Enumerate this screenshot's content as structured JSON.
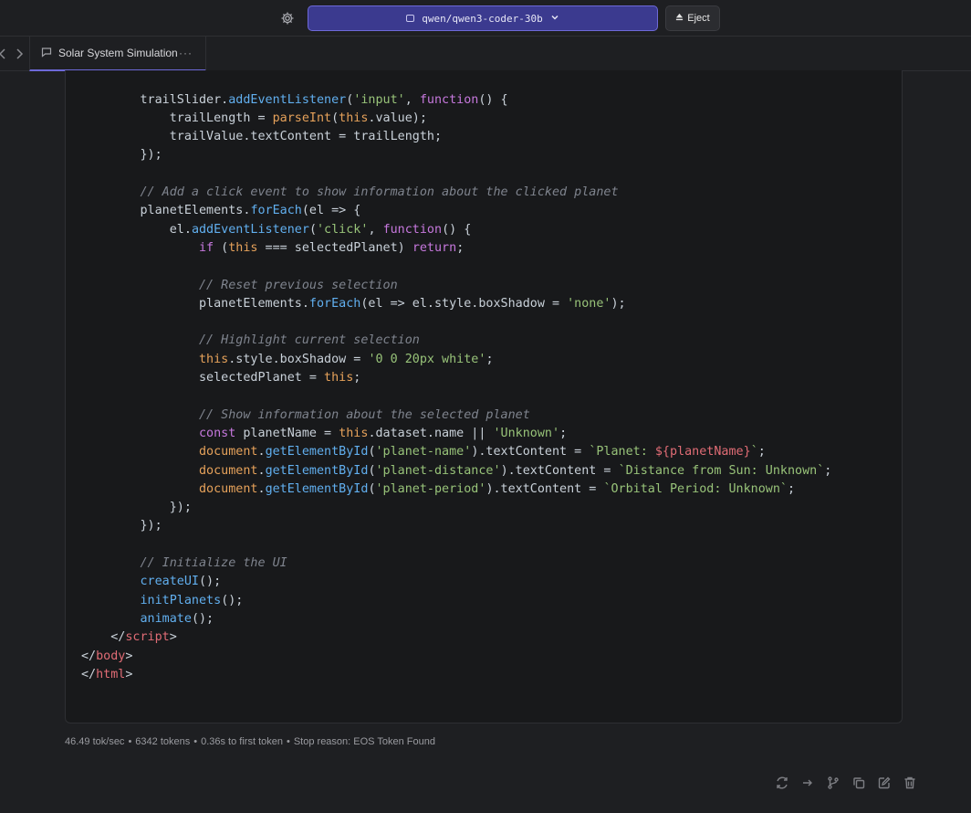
{
  "topbar": {
    "model_name": "qwen/qwen3-coder-30b",
    "eject_label": "Eject"
  },
  "tab": {
    "title": "Solar System Simulation",
    "more_label": "···"
  },
  "code_lines": [
    [
      [
        "p",
        "        });"
      ]
    ],
    [
      [
        "p",
        ""
      ]
    ],
    [
      [
        "p",
        "        trailSlider."
      ],
      [
        "f",
        "addEventListener"
      ],
      [
        "p",
        "("
      ],
      [
        "s",
        "'input'"
      ],
      [
        "p",
        ", "
      ],
      [
        "k",
        "function"
      ],
      [
        "p",
        "() {"
      ]
    ],
    [
      [
        "p",
        "            trailLength = "
      ],
      [
        "t",
        "parseInt"
      ],
      [
        "p",
        "("
      ],
      [
        "t",
        "this"
      ],
      [
        "p",
        ".value);"
      ]
    ],
    [
      [
        "p",
        "            trailValue.textContent = trailLength;"
      ]
    ],
    [
      [
        "p",
        "        });"
      ]
    ],
    [
      [
        "p",
        ""
      ]
    ],
    [
      [
        "c",
        "        // Add a click event to show information about the clicked planet"
      ]
    ],
    [
      [
        "p",
        "        planetElements."
      ],
      [
        "f",
        "forEach"
      ],
      [
        "p",
        "(el => {"
      ]
    ],
    [
      [
        "p",
        "            el."
      ],
      [
        "f",
        "addEventListener"
      ],
      [
        "p",
        "("
      ],
      [
        "s",
        "'click'"
      ],
      [
        "p",
        ", "
      ],
      [
        "k",
        "function"
      ],
      [
        "p",
        "() {"
      ]
    ],
    [
      [
        "p",
        "                "
      ],
      [
        "k",
        "if"
      ],
      [
        "p",
        " ("
      ],
      [
        "t",
        "this"
      ],
      [
        "p",
        " === selectedPlanet) "
      ],
      [
        "k",
        "return"
      ],
      [
        "p",
        ";"
      ]
    ],
    [
      [
        "p",
        ""
      ]
    ],
    [
      [
        "c",
        "                // Reset previous selection"
      ]
    ],
    [
      [
        "p",
        "                planetElements."
      ],
      [
        "f",
        "forEach"
      ],
      [
        "p",
        "(el => el.style.boxShadow = "
      ],
      [
        "s",
        "'none'"
      ],
      [
        "p",
        ");"
      ]
    ],
    [
      [
        "p",
        ""
      ]
    ],
    [
      [
        "c",
        "                // Highlight current selection"
      ]
    ],
    [
      [
        "p",
        "                "
      ],
      [
        "t",
        "this"
      ],
      [
        "p",
        ".style.boxShadow = "
      ],
      [
        "s",
        "'0 0 20px white'"
      ],
      [
        "p",
        ";"
      ]
    ],
    [
      [
        "p",
        "                selectedPlanet = "
      ],
      [
        "t",
        "this"
      ],
      [
        "p",
        ";"
      ]
    ],
    [
      [
        "p",
        ""
      ]
    ],
    [
      [
        "c",
        "                // Show information about the selected planet"
      ]
    ],
    [
      [
        "p",
        "                "
      ],
      [
        "k",
        "const"
      ],
      [
        "p",
        " planetName = "
      ],
      [
        "t",
        "this"
      ],
      [
        "p",
        ".dataset.name || "
      ],
      [
        "s",
        "'Unknown'"
      ],
      [
        "p",
        ";"
      ]
    ],
    [
      [
        "p",
        "                "
      ],
      [
        "t",
        "document"
      ],
      [
        "p",
        "."
      ],
      [
        "f",
        "getElementById"
      ],
      [
        "p",
        "("
      ],
      [
        "s",
        "'planet-name'"
      ],
      [
        "p",
        ").textContent = "
      ],
      [
        "s",
        "`Planet: "
      ],
      [
        "g",
        "${planetName}"
      ],
      [
        "s",
        "`"
      ],
      [
        "p",
        ";"
      ]
    ],
    [
      [
        "p",
        "                "
      ],
      [
        "t",
        "document"
      ],
      [
        "p",
        "."
      ],
      [
        "f",
        "getElementById"
      ],
      [
        "p",
        "("
      ],
      [
        "s",
        "'planet-distance'"
      ],
      [
        "p",
        ").textContent = "
      ],
      [
        "s",
        "`Distance from Sun: Unknown`"
      ],
      [
        "p",
        ";"
      ]
    ],
    [
      [
        "p",
        "                "
      ],
      [
        "t",
        "document"
      ],
      [
        "p",
        "."
      ],
      [
        "f",
        "getElementById"
      ],
      [
        "p",
        "("
      ],
      [
        "s",
        "'planet-period'"
      ],
      [
        "p",
        ").textContent = "
      ],
      [
        "s",
        "`Orbital Period: Unknown`"
      ],
      [
        "p",
        ";"
      ]
    ],
    [
      [
        "p",
        "            });"
      ]
    ],
    [
      [
        "p",
        "        });"
      ]
    ],
    [
      [
        "p",
        ""
      ]
    ],
    [
      [
        "c",
        "        // Initialize the UI"
      ]
    ],
    [
      [
        "p",
        "        "
      ],
      [
        "f",
        "createUI"
      ],
      [
        "p",
        "();"
      ]
    ],
    [
      [
        "p",
        "        "
      ],
      [
        "f",
        "initPlanets"
      ],
      [
        "p",
        "();"
      ]
    ],
    [
      [
        "p",
        "        "
      ],
      [
        "f",
        "animate"
      ],
      [
        "p",
        "();"
      ]
    ],
    [
      [
        "p",
        "    </"
      ],
      [
        "g",
        "script"
      ],
      [
        "p",
        ">"
      ]
    ],
    [
      [
        "p",
        "</"
      ],
      [
        "g",
        "body"
      ],
      [
        "p",
        ">"
      ]
    ],
    [
      [
        "p",
        "</"
      ],
      [
        "g",
        "html"
      ],
      [
        "p",
        ">"
      ]
    ]
  ],
  "stats": {
    "speed": "46.49 tok/sec",
    "tokens": "6342 tokens",
    "first_token": "0.36s to first token",
    "stop_reason": "Stop reason: EOS Token Found",
    "separator": "•"
  },
  "icons": {
    "settings": "gear-icon",
    "model": "chip-icon",
    "dropdown": "chevron-down-icon",
    "eject": "eject-icon",
    "chat": "chat-bubble-icon",
    "actions": [
      "regenerate-icon",
      "continue-icon",
      "branch-icon",
      "copy-icon",
      "edit-icon",
      "delete-icon"
    ]
  },
  "colors": {
    "accent": "#3b3a8f",
    "keyword": "#c678dd",
    "string": "#98c379",
    "function": "#61afef",
    "builtin": "#e5a15a",
    "comment": "#7f848e",
    "tag": "#e06c75"
  }
}
